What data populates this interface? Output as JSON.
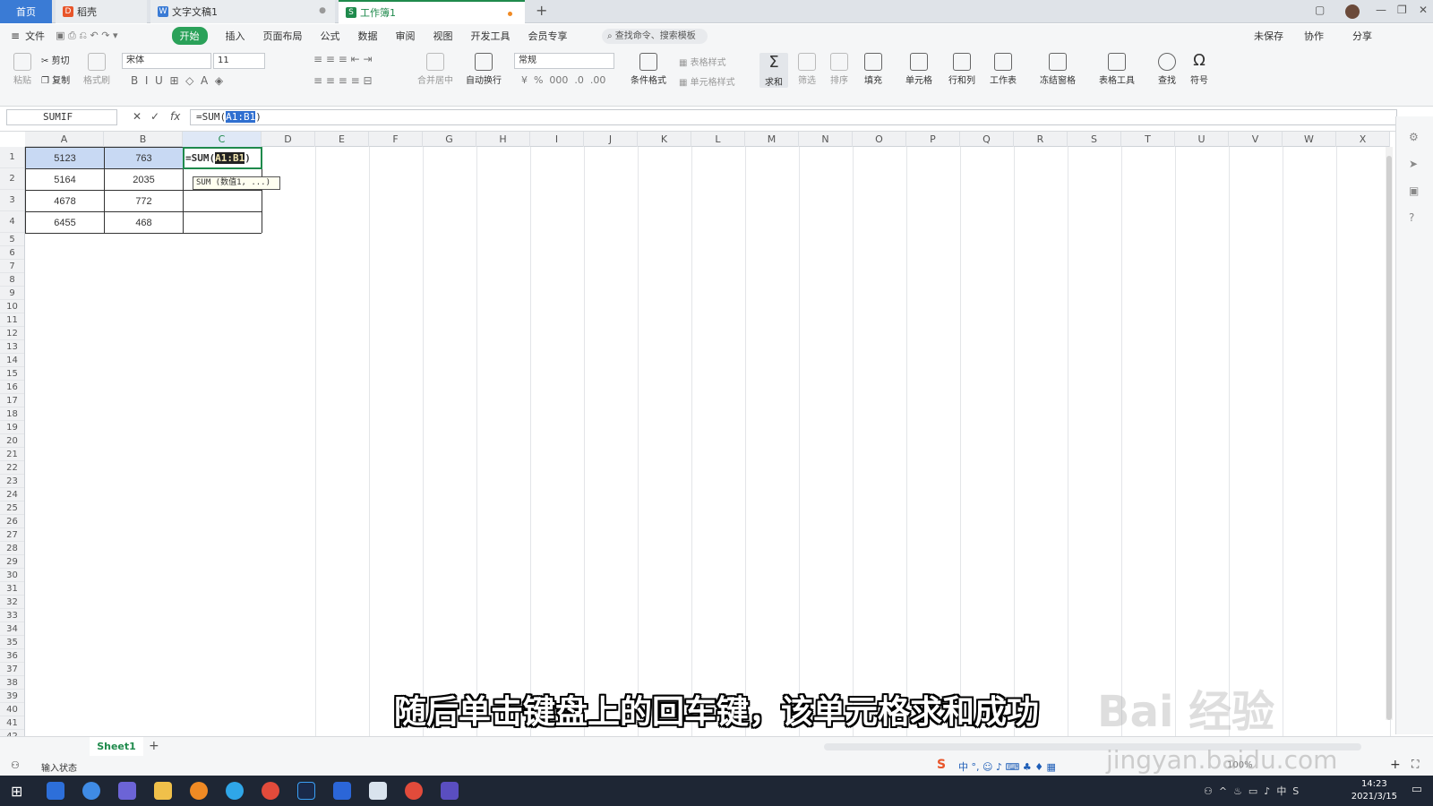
{
  "tabs": {
    "home": "首页",
    "t2": "稻壳",
    "t3": "文字文稿1",
    "t4": "工作簿1"
  },
  "menubar": {
    "file": "文件",
    "items": [
      "开始",
      "插入",
      "页面布局",
      "公式",
      "数据",
      "审阅",
      "视图",
      "开发工具",
      "会员专享"
    ],
    "search": "查找命令、搜索模板",
    "right": [
      "未保存",
      "协作",
      "分享"
    ]
  },
  "ribbon": {
    "cut": "剪切",
    "copy": "复制",
    "paste": "粘贴",
    "format_painter": "格式刷",
    "font": "宋体",
    "size": "11",
    "merge": "合并居中",
    "wrap": "自动换行",
    "numfmt": "常规",
    "cond_fmt": "条件格式",
    "table_style": "表格样式",
    "cell_style": "单元格样式",
    "sum": "求和",
    "filter": "筛选",
    "sort": "排序",
    "fill": "填充",
    "cell": "单元格",
    "rowcol": "行和列",
    "sheet": "工作表",
    "freeze": "冻结窗格",
    "tools": "表格工具",
    "find": "查找",
    "symbol": "符号"
  },
  "formula_bar": {
    "name_box": "SUMIF",
    "formula_prefix": "=SUM(",
    "formula_sel": "A1:B1",
    "formula_suffix": ")"
  },
  "columns": [
    "A",
    "B",
    "C",
    "D",
    "E",
    "F",
    "G",
    "H",
    "I",
    "J",
    "K",
    "L",
    "M",
    "N",
    "O",
    "P",
    "Q",
    "R",
    "S",
    "T",
    "U",
    "V",
    "W",
    "X"
  ],
  "rows": [
    "1",
    "2",
    "3",
    "4",
    "5",
    "6",
    "7",
    "8",
    "9",
    "10",
    "11",
    "12",
    "13",
    "14",
    "15",
    "16",
    "17",
    "18",
    "19",
    "20",
    "21",
    "22",
    "23",
    "24",
    "25",
    "26",
    "27",
    "28",
    "29",
    "30",
    "31",
    "32",
    "33",
    "34",
    "35",
    "36",
    "37",
    "38",
    "39",
    "40",
    "41",
    "42"
  ],
  "data": [
    [
      "5123",
      "763"
    ],
    [
      "5164",
      "2035"
    ],
    [
      "4678",
      "772"
    ],
    [
      "6455",
      "468"
    ]
  ],
  "cell_c1": {
    "prefix": "=SUM(",
    "sel": "A1:B1",
    "suffix": ")"
  },
  "tooltip": "SUM (数值1, ...)",
  "sheet": {
    "tab": "Sheet1",
    "add": "+"
  },
  "status": {
    "mode": "输入状态",
    "zoom": "100%"
  },
  "subtitle": "随后单击键盘上的回车键，该单元格求和成功",
  "watermark": {
    "logo": "Bai 经验",
    "url": "jingyan.baidu.com"
  },
  "clock": {
    "time": "14:23",
    "date": "2021/3/15"
  },
  "colors": {
    "accent": "#2aa159",
    "selection": "#2f6fd0",
    "highlight": "#c8d9f3"
  }
}
